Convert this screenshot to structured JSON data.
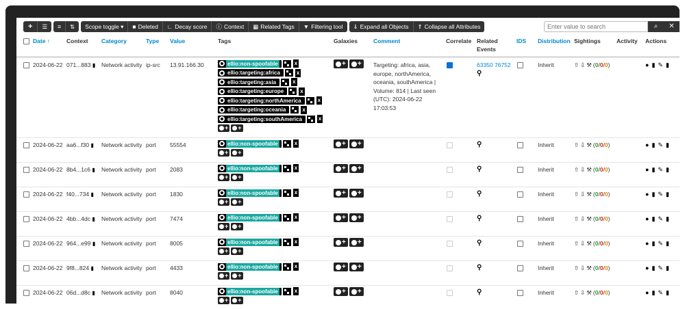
{
  "toolbar": {
    "add_label": "+",
    "list_icon": "list-icon",
    "menu_icon": "lines-icon",
    "shuffle_icon": "shuffle-icon",
    "scope_toggle": "Scope toggle ▾",
    "deleted": "Deleted",
    "decay_score": "Decay score",
    "context": "Context",
    "related_tags": "Related Tags",
    "filtering_tool": "Filtering tool",
    "expand_all": "Expand all Objects",
    "collapse_all": "Collapse all Attributes"
  },
  "search": {
    "placeholder": "Enter value to search",
    "search_icon": "⌕",
    "clear_icon": "✕"
  },
  "headers": {
    "date": "Date ↑",
    "context": "Context",
    "category": "Category",
    "type": "Type",
    "value": "Value",
    "tags": "Tags",
    "galaxies": "Galaxies",
    "comment": "Comment",
    "correlate": "Correlate",
    "related_events": "Related Events",
    "ids": "IDS",
    "distribution": "Distribution",
    "sightings": "Sightings",
    "activity": "Activity",
    "actions": "Actions"
  },
  "rows": [
    {
      "date": "2024-06-22",
      "context": "071...883",
      "category": "Network activity",
      "type": "ip-src",
      "value": "13.91.166.30",
      "tags": [
        "ellio:non-spoofable",
        "ellio:targeting:africa",
        "ellio:targeting:asia",
        "ellio:targeting:europe",
        "ellio:targeting:northAmerica",
        "ellio:targeting:oceania",
        "ellio:targeting:southAmerica"
      ],
      "comment": "Targeting: africa, asia, europe, northAmerica, oceania, southAmerica | Volume: 814 | Last seen (UTC): 2024-06-22 17:03:53",
      "correlate": true,
      "related": "63350 76752",
      "ids": false,
      "distribution": "Inherit",
      "s_g": "0",
      "s_r": "0",
      "s_o": "0"
    },
    {
      "date": "2024-06-22",
      "context": "aa6...f30",
      "category": "Network activity",
      "type": "port",
      "value": "55554",
      "tags": [
        "ellio:non-spoofable"
      ],
      "comment": "",
      "correlate": false,
      "related": "",
      "ids": false,
      "distribution": "Inherit",
      "s_g": "0",
      "s_r": "0",
      "s_o": "0"
    },
    {
      "date": "2024-06-22",
      "context": "8b4...1c6",
      "category": "Network activity",
      "type": "port",
      "value": "2083",
      "tags": [
        "ellio:non-spoofable"
      ],
      "comment": "",
      "correlate": false,
      "related": "",
      "ids": false,
      "distribution": "Inherit",
      "s_g": "0",
      "s_r": "0",
      "s_o": "0"
    },
    {
      "date": "2024-06-22",
      "context": "f40...734",
      "category": "Network activity",
      "type": "port",
      "value": "1830",
      "tags": [
        "ellio:non-spoofable"
      ],
      "comment": "",
      "correlate": false,
      "related": "",
      "ids": false,
      "distribution": "Inherit",
      "s_g": "0",
      "s_r": "0",
      "s_o": "0"
    },
    {
      "date": "2024-06-22",
      "context": "4bb...4dc",
      "category": "Network activity",
      "type": "port",
      "value": "7474",
      "tags": [
        "ellio:non-spoofable"
      ],
      "comment": "",
      "correlate": false,
      "related": "",
      "ids": false,
      "distribution": "Inherit",
      "s_g": "0",
      "s_r": "0",
      "s_o": "0"
    },
    {
      "date": "2024-06-22",
      "context": "964...e99",
      "category": "Network activity",
      "type": "port",
      "value": "8005",
      "tags": [
        "ellio:non-spoofable"
      ],
      "comment": "",
      "correlate": false,
      "related": "",
      "ids": false,
      "distribution": "Inherit",
      "s_g": "0",
      "s_r": "0",
      "s_o": "0"
    },
    {
      "date": "2024-06-22",
      "context": "9f8...824",
      "category": "Network activity",
      "type": "port",
      "value": "4433",
      "tags": [
        "ellio:non-spoofable"
      ],
      "comment": "",
      "correlate": false,
      "related": "",
      "ids": false,
      "distribution": "Inherit",
      "s_g": "0",
      "s_r": "0",
      "s_o": "0"
    },
    {
      "date": "2024-06-22",
      "context": "06d...d8c",
      "category": "Network activity",
      "type": "port",
      "value": "8040",
      "tags": [
        "ellio:non-spoofable"
      ],
      "comment": "",
      "correlate": false,
      "related": "",
      "ids": false,
      "distribution": "Inherit",
      "s_g": "0",
      "s_r": "0",
      "s_o": "0"
    }
  ],
  "colors": {
    "accent": "#0088cc",
    "tag_teal": "#1aa8a0",
    "dark": "#333333"
  }
}
